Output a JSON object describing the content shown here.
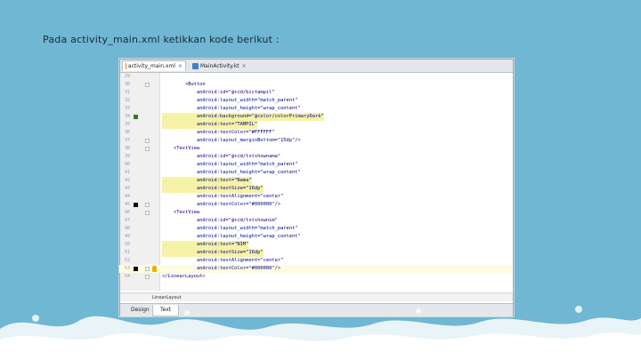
{
  "slide": {
    "title": "Pada activity_main.xml ketikkan kode berikut :"
  },
  "editor": {
    "tabs": [
      {
        "label": "activity_main.xml",
        "close": "×",
        "active": true,
        "icon_color": "#e07a2a"
      },
      {
        "label": "MainActivity.kt",
        "close": "×",
        "active": false,
        "icon_color": "#3b82c4"
      }
    ],
    "lines": [
      {
        "n": "29",
        "text": ""
      },
      {
        "n": "30",
        "text": "        <Button"
      },
      {
        "n": "31",
        "text": "            android:id=\"@+id/bictampil\""
      },
      {
        "n": "32",
        "text": "            android:layout_width=\"match_parent\""
      },
      {
        "n": "33",
        "text": "            android:layout_height=\"wrap_content\""
      },
      {
        "n": "34",
        "text": "            android:background=\"@color/colorPrimaryDark\""
      },
      {
        "n": "35",
        "text": "            android:text=\"TAMPIL\""
      },
      {
        "n": "36",
        "text": "            android:textColor=\"#FFFFFF\""
      },
      {
        "n": "37",
        "text": "            android:layout_marginBottom=\"15dp\"/>"
      },
      {
        "n": "38",
        "text": "    <TextView"
      },
      {
        "n": "39",
        "text": "            android:id=\"@+id/txtshownama\""
      },
      {
        "n": "40",
        "text": "            android:layout_width=\"match_parent\""
      },
      {
        "n": "41",
        "text": "            android:layout_height=\"wrap_content\""
      },
      {
        "n": "42",
        "text": "            android:text=\"Nama\""
      },
      {
        "n": "43",
        "text": "            android:textSize=\"16dp\""
      },
      {
        "n": "44",
        "text": "            android:textAlignment=\"center\""
      },
      {
        "n": "45",
        "text": "            android:textColor=\"#000000\"/>"
      },
      {
        "n": "46",
        "text": "    <TextView"
      },
      {
        "n": "47",
        "text": "            android:id=\"@+id/txtshownim\""
      },
      {
        "n": "48",
        "text": "            android:layout_width=\"match_parent\""
      },
      {
        "n": "49",
        "text": "            android:layout_height=\"wrap_content\""
      },
      {
        "n": "50",
        "text": "            android:text=\"NIM\""
      },
      {
        "n": "51",
        "text": "            android:textSize=\"16dp\""
      },
      {
        "n": "52",
        "text": "            android:textAlignment=\"center\""
      },
      {
        "n": "53",
        "text": "            android:textColor=\"#000000\"/>"
      },
      {
        "n": "54",
        "text": "</LinearLayout>"
      }
    ],
    "breadcrumb": "LinearLayout",
    "bottom_tabs": [
      "Design",
      "Text"
    ],
    "active_bottom_tab": "Text"
  }
}
